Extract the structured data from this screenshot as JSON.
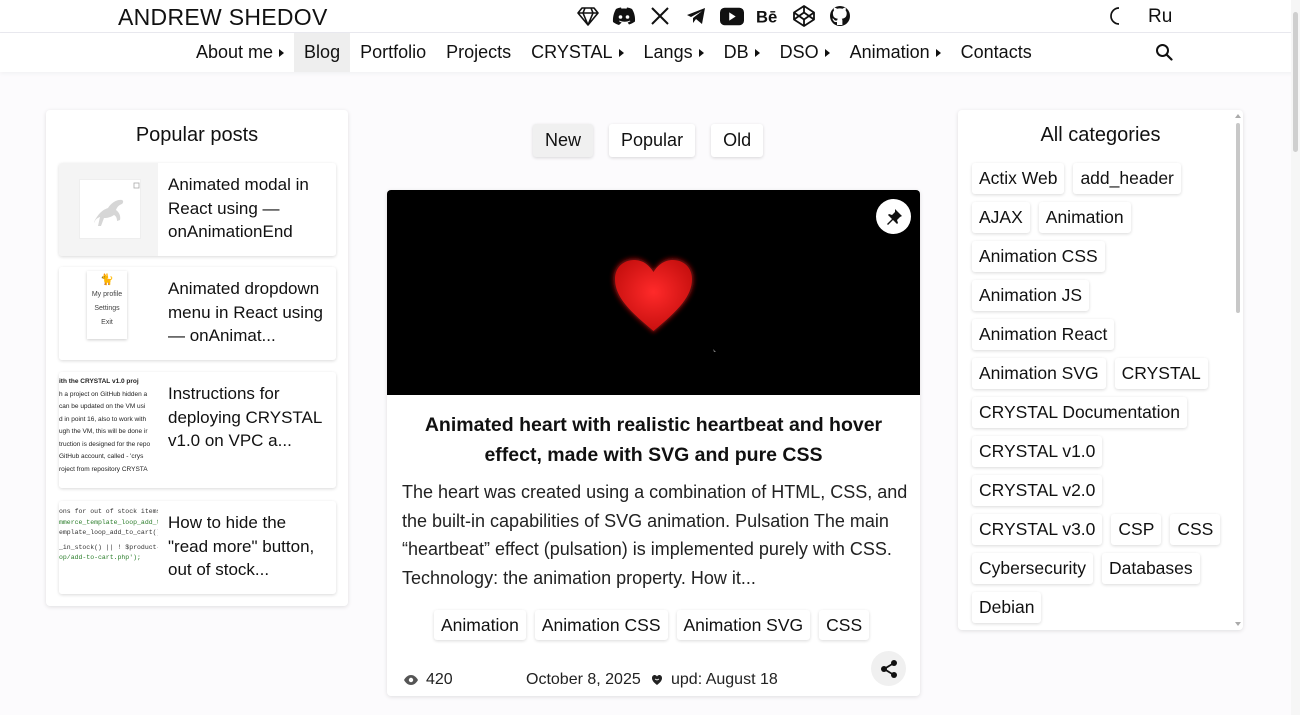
{
  "brand": "ANDREW SHEDOV",
  "socials": [
    "gem-icon",
    "discord-icon",
    "x-icon",
    "telegram-icon",
    "youtube-icon",
    "behance-icon",
    "codepen-icon",
    "github-icon"
  ],
  "lang": "Ru",
  "nav": [
    {
      "label": "About me",
      "caret": true
    },
    {
      "label": "Blog",
      "caret": false,
      "active": true
    },
    {
      "label": "Portfolio",
      "caret": false
    },
    {
      "label": "Projects",
      "caret": false
    },
    {
      "label": "CRYSTAL",
      "caret": true
    },
    {
      "label": "Langs",
      "caret": true
    },
    {
      "label": "DB",
      "caret": true
    },
    {
      "label": "DSO",
      "caret": true
    },
    {
      "label": "Animation",
      "caret": true
    },
    {
      "label": "Contacts",
      "caret": false
    }
  ],
  "popular": {
    "title": "Popular posts",
    "posts": [
      {
        "title": "Animated modal in React using — onAnimationEnd"
      },
      {
        "title": "Animated dropdown menu in React using — onAnimat..."
      },
      {
        "title": "Instructions for deploying CRYSTAL v1.0 on VPC a..."
      },
      {
        "title": "How to hide the \"read more\" button, out of stock..."
      }
    ],
    "thumb2_menu": [
      "My profile",
      "Settings",
      "Exit"
    ],
    "thumb3_lines": [
      "ith the CRYSTAL v1.0 proj",
      "h a project on GitHub hidden a",
      "can be updated on the VM usi",
      "d in point 16, also to work with",
      "ugh the VM, this will be done ir",
      "truction is designed for the repo",
      " GitHub account, called - 'crys",
      "roject from repository CRYSTA"
    ],
    "thumb4_lines": [
      "ons for out of stock items",
      "mmerce_template_loop_add_t",
      "emplate_loop_add_to_cart()",
      "_in_stock() || ! $product-",
      "op/add-to-cart.php');"
    ]
  },
  "filters": [
    {
      "label": "New",
      "active": true
    },
    {
      "label": "Popular",
      "active": false
    },
    {
      "label": "Old",
      "active": false
    }
  ],
  "main": {
    "title": "Animated heart with realistic heartbeat and hover effect, made with SVG and pure CSS",
    "excerpt": "The heart was created using a combination of HTML, CSS, and the built-in capabilities of SVG animation. Pulsation The main “heartbeat” effect (pulsation) is implemented purely with CSS. Technology: the animation property. How it...",
    "tags": [
      "Animation",
      "Animation CSS",
      "Animation SVG",
      "CSS"
    ],
    "views": "420",
    "date": "October 8, 2025",
    "updated": "upd: August 18"
  },
  "categories": {
    "title": "All categories",
    "items": [
      "Actix Web",
      "add_header",
      "AJAX",
      "Animation",
      "Animation CSS",
      "Animation JS",
      "Animation React",
      "Animation SVG",
      "CRYSTAL",
      "CRYSTAL Documentation",
      "CRYSTAL v1.0",
      "CRYSTAL v2.0",
      "CRYSTAL v3.0",
      "CSP",
      "CSS",
      "Cybersecurity",
      "Databases",
      "Debian"
    ]
  },
  "colors": {
    "heart": "#e3191c",
    "hero_bg": "#000000",
    "active_nav": "#eeeeee"
  }
}
